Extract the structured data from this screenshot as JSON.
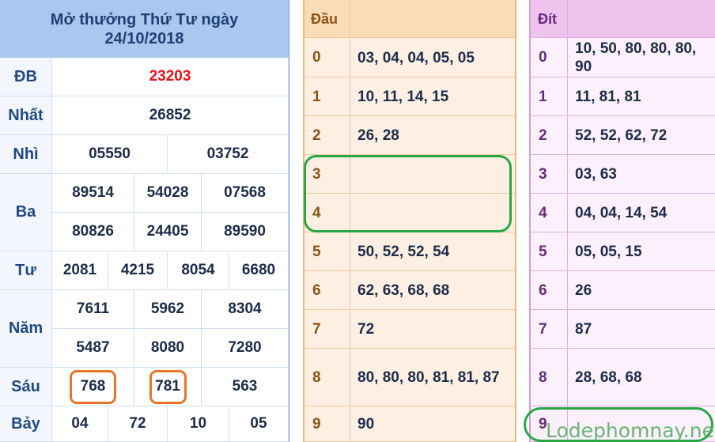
{
  "results": {
    "title": "Mở thưởng Thứ Tư ngày",
    "date": "24/10/2018",
    "db_label": "ĐB",
    "db": "23203",
    "nhat_label": "Nhất",
    "nhat": "26852",
    "nhi_label": "Nhì",
    "nhi": [
      "05550",
      "03752"
    ],
    "ba_label": "Ba",
    "ba": [
      "89514",
      "54028",
      "07568",
      "80826",
      "24405",
      "89590"
    ],
    "tu_label": "Tư",
    "tu": [
      "2081",
      "4215",
      "8054",
      "6680"
    ],
    "nam_label": "Năm",
    "nam": [
      "7611",
      "5962",
      "8304",
      "5487",
      "8080",
      "7280"
    ],
    "sau_label": "Sáu",
    "sau": [
      "768",
      "781",
      "563"
    ],
    "bay_label": "Bảy",
    "bay": [
      "04",
      "72",
      "10",
      "05"
    ]
  },
  "dau": {
    "header": "Đầu",
    "rows": [
      {
        "k": "0",
        "v": "03, 04, 04, 05, 05"
      },
      {
        "k": "1",
        "v": "10, 11, 14, 15"
      },
      {
        "k": "2",
        "v": "26, 28"
      },
      {
        "k": "3",
        "v": ""
      },
      {
        "k": "4",
        "v": ""
      },
      {
        "k": "5",
        "v": "50, 52, 52, 54"
      },
      {
        "k": "6",
        "v": "62, 63, 68, 68"
      },
      {
        "k": "7",
        "v": "72"
      },
      {
        "k": "8",
        "v": "80, 80, 80, 81, 81, 87"
      },
      {
        "k": "9",
        "v": "90"
      }
    ]
  },
  "dit": {
    "header": "Đít",
    "rows": [
      {
        "k": "0",
        "v": "10, 50, 80, 80, 80, 90"
      },
      {
        "k": "1",
        "v": "11, 81, 81"
      },
      {
        "k": "2",
        "v": "52, 52, 62, 72"
      },
      {
        "k": "3",
        "v": "03, 63"
      },
      {
        "k": "4",
        "v": "04, 04, 14, 54"
      },
      {
        "k": "5",
        "v": "05, 05, 15"
      },
      {
        "k": "6",
        "v": "26"
      },
      {
        "k": "7",
        "v": "87"
      },
      {
        "k": "8",
        "v": "28, 68, 68"
      },
      {
        "k": "9",
        "v": ""
      }
    ]
  },
  "watermark": "Lodephomnay.net",
  "colors": {
    "header_blue": "#a8c8f0",
    "red_number": "#e8141a",
    "dau_bg": "#fdf0e2",
    "dau_header": "#fbdcb8",
    "dit_bg": "#fbf0fb",
    "dit_header": "#eec4ee",
    "orange_mark": "#e8762a",
    "green_mark": "#27a844"
  }
}
